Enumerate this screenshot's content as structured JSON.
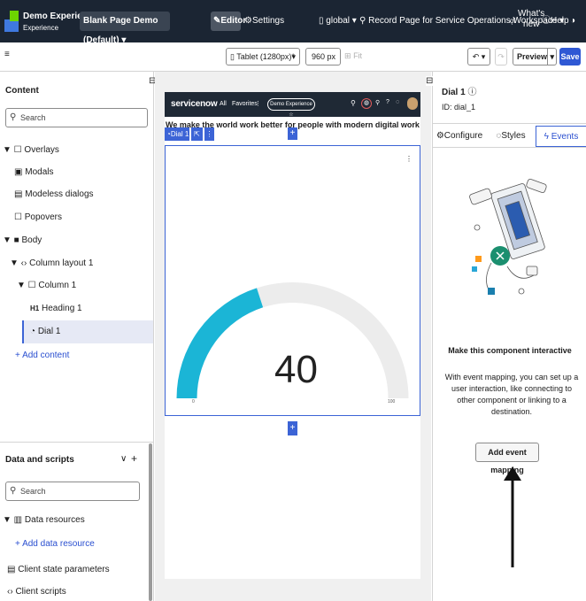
{
  "colors": {
    "header": "#1b2533",
    "accent": "#3c64d6",
    "dial_fill": "#1bb5d6",
    "dial_track": "#ececec"
  },
  "header": {
    "app_title": "Demo Experience",
    "app_subtitle": "Experience",
    "page_select": "Blank Page Demo (Default)",
    "editor_label": "Editor",
    "settings_label": "Settings",
    "scope_label": "global",
    "record_page_label": "Record Page for Service Operations Workspace",
    "whats_new_line1": "What's",
    "whats_new_line2": "new",
    "help_label": "Help"
  },
  "toolbar": {
    "menu_icon": "≡",
    "device_select": "Tablet (1280px)*",
    "width_value": "960",
    "width_unit": "px",
    "fit_label": "Fit",
    "preview_label": "Preview",
    "save_label": "Save"
  },
  "content_panel": {
    "title": "Content",
    "search_placeholder": "Search",
    "tree": [
      {
        "label": "Overlays",
        "icon": "▼ ☐"
      },
      {
        "label": "Modals",
        "icon": "▣"
      },
      {
        "label": "Modeless dialogs",
        "icon": "▤"
      },
      {
        "label": "Popovers",
        "icon": "☐"
      },
      {
        "label": "Body",
        "icon": "▼ ■"
      },
      {
        "label": "Column layout 1",
        "icon": "▼ ‹›"
      },
      {
        "label": "Column 1",
        "icon": "▼ ☐"
      },
      {
        "label": "Heading 1",
        "icon": "H1"
      },
      {
        "label": "Dial 1",
        "icon": "◔"
      }
    ],
    "add_content_label": "+ Add content"
  },
  "data_panel": {
    "title": "Data and scripts",
    "search_placeholder": "Search",
    "data_resources_label": "Data resources",
    "add_data_resource_label": "+ Add data resource",
    "client_state_label": "Client state parameters",
    "client_scripts_label": "Client scripts"
  },
  "canvas": {
    "sn_logo": "servicenow",
    "nav_all": "All",
    "nav_favorites": "Favorites",
    "experience_pill": "Demo Experience ☆",
    "heading_text": "We make the world work better for people with modern digital workflows",
    "dial_tag": "Dial 1",
    "dial_value": "40",
    "dial_min": "0",
    "dial_max": "100",
    "dial_fraction": 0.4
  },
  "config_panel": {
    "component_name": "Dial 1",
    "component_id": "ID: dial_1",
    "tabs": [
      "Configure",
      "Styles",
      "Events"
    ],
    "active_tab": "Events",
    "empty_title": "Make this component interactive",
    "empty_body": "With event mapping, you can set up a user interaction, like connecting to other component or linking to a destination.",
    "add_event_label": "Add event mapping"
  }
}
